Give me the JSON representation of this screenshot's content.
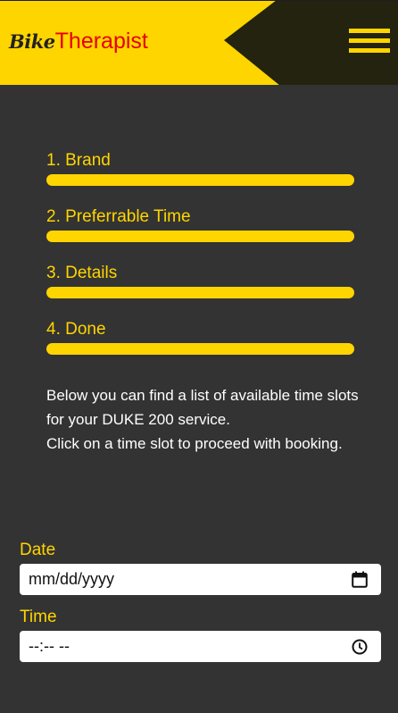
{
  "header": {
    "logo_bike": "Bike",
    "logo_therapist": "Therapist",
    "menu_icon": "hamburger-menu-icon",
    "brand_yellow": "#ffd500",
    "brand_dark": "#23230f",
    "brand_red": "#e60000"
  },
  "steps": [
    {
      "label": "1. Brand"
    },
    {
      "label": "2. Preferrable Time"
    },
    {
      "label": "3. Details"
    },
    {
      "label": "4. Done"
    }
  ],
  "info": {
    "line1": "Below you can find a list of available time slots for your DUKE 200 service.",
    "line2": "Click on a time slot to proceed with booking."
  },
  "form": {
    "date_label": "Date",
    "date_value": "mm/dd/yyyy",
    "date_icon": "calendar-icon",
    "time_label": "Time",
    "time_value": "--:-- --",
    "time_icon": "clock-icon"
  },
  "colors": {
    "background": "#333333",
    "accent": "#ffd500",
    "text": "#ffffff"
  }
}
